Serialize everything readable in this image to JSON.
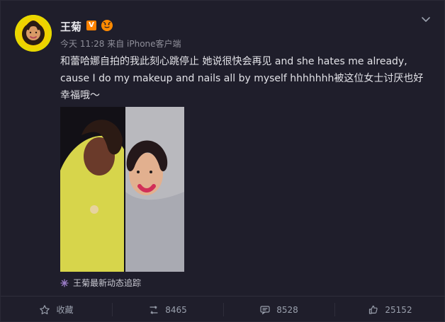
{
  "post": {
    "user_name": "王菊",
    "vip_badge": "V",
    "meta": "今天 11:28 来自 iPhone客户端",
    "content": "和蕾哈娜自拍的我此刻心跳停止 她说很快会再见 and she hates me already, cause I do my makeup and nails all by myself hhhhhhh被这位女士讨厌也好幸福哦～",
    "trace_label": "王菊最新动态追踪"
  },
  "actions": {
    "favorite_label": "收藏",
    "repost_count": "8465",
    "comment_count": "8528",
    "like_count": "25152"
  },
  "colors": {
    "background": "#1f1e2b",
    "text": "#e2e2e7",
    "muted": "#8f8f9a",
    "vip": "#ff8200"
  }
}
